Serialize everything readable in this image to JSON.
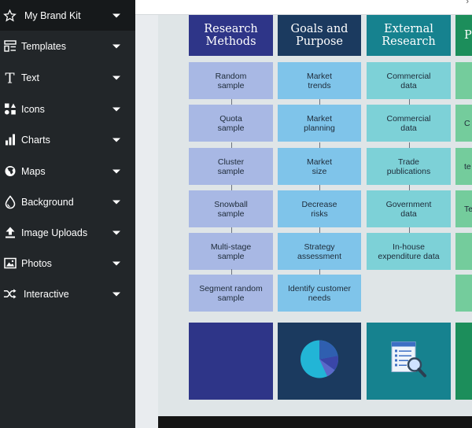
{
  "sidebar": {
    "items": [
      {
        "label": "My Brand Kit",
        "icon": "star-icon"
      },
      {
        "label": "Templates",
        "icon": "templates-icon"
      },
      {
        "label": "Text",
        "icon": "text-icon"
      },
      {
        "label": "Icons",
        "icon": "shapes-icon"
      },
      {
        "label": "Charts",
        "icon": "bar-chart-icon"
      },
      {
        "label": "Maps",
        "icon": "globe-icon"
      },
      {
        "label": "Background",
        "icon": "droplet-icon"
      },
      {
        "label": "Image Uploads",
        "icon": "upload-icon"
      },
      {
        "label": "Photos",
        "icon": "photo-icon"
      },
      {
        "label": "Interactive",
        "icon": "shuffle-icon"
      }
    ]
  },
  "canvas": {
    "columns": [
      {
        "title": "Research\nMethods",
        "header_color": "#2e3588",
        "cell_color": "#a8b8e4",
        "footer_color": "#2e3588",
        "footer_icon": "",
        "cells": [
          "Random\nsample",
          "Quota\nsample",
          "Cluster\nsample",
          "Snowball\nsample",
          "Multi-stage\nsample",
          "Segment random\nsample"
        ]
      },
      {
        "title": "Goals and\nPurpose",
        "header_color": "#1b3a5f",
        "cell_color": "#7fc4ea",
        "footer_color": "#1b3a5f",
        "footer_icon": "pie-chart-icon",
        "cells": [
          "Market\ntrends",
          "Market\nplanning",
          "Market\nsize",
          "Decrease\nrisks",
          "Strategy\nassessment",
          "Identify customer\nneeds"
        ]
      },
      {
        "title": "External\nResearch",
        "header_color": "#16828f",
        "cell_color": "#7dd1d7",
        "footer_color": "#16828f",
        "footer_icon": "document-search-icon",
        "cells": [
          "Commercial\ndata",
          "Commercial\ndata",
          "Trade\npublications",
          "Government\ndata",
          "In-house\nexpenditure data"
        ]
      },
      {
        "title": "P",
        "header_color": "#1c8e5b",
        "cell_color": "#74cc9c",
        "footer_color": "#1c8e5b",
        "footer_icon": "",
        "cells": [
          "",
          "C",
          "te",
          "Te",
          "",
          ""
        ]
      }
    ]
  }
}
